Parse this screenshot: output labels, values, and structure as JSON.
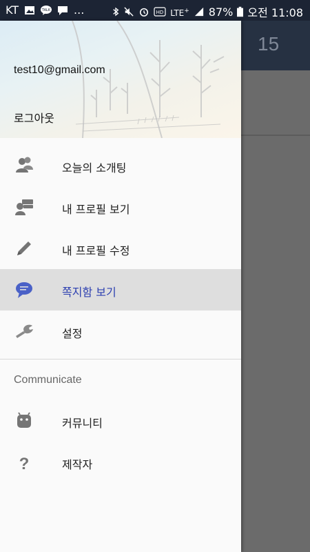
{
  "status_bar": {
    "carrier": "KT",
    "more": "...",
    "network": "LTE",
    "battery": "87%",
    "time": "오전 11:08",
    "icons": [
      "image-icon",
      "talk-icon",
      "message-icon",
      "bluetooth-icon",
      "mute-icon",
      "alarm-icon",
      "hd-icon",
      "lte-icon",
      "signal-icon",
      "battery-icon"
    ]
  },
  "app": {
    "title": "15",
    "toolbar_color": "#263142"
  },
  "drawer": {
    "email": "test10@gmail.com",
    "logout_label": "로그아웃",
    "items": [
      {
        "label": "오늘의 소개팅",
        "icon": "people-icon"
      },
      {
        "label": "내 프로필 보기",
        "icon": "profile-card-icon"
      },
      {
        "label": "내 프로필 수정",
        "icon": "pencil-icon"
      },
      {
        "label": "쪽지함 보기",
        "icon": "chat-bubble-icon",
        "active": true
      },
      {
        "label": "설정",
        "icon": "wrench-icon"
      }
    ],
    "section_title": "Communicate",
    "community_items": [
      {
        "label": "커뮤니티",
        "icon": "android-icon"
      },
      {
        "label": "제작자",
        "icon": "question-icon"
      }
    ],
    "active_color": "#2c3fb0"
  }
}
